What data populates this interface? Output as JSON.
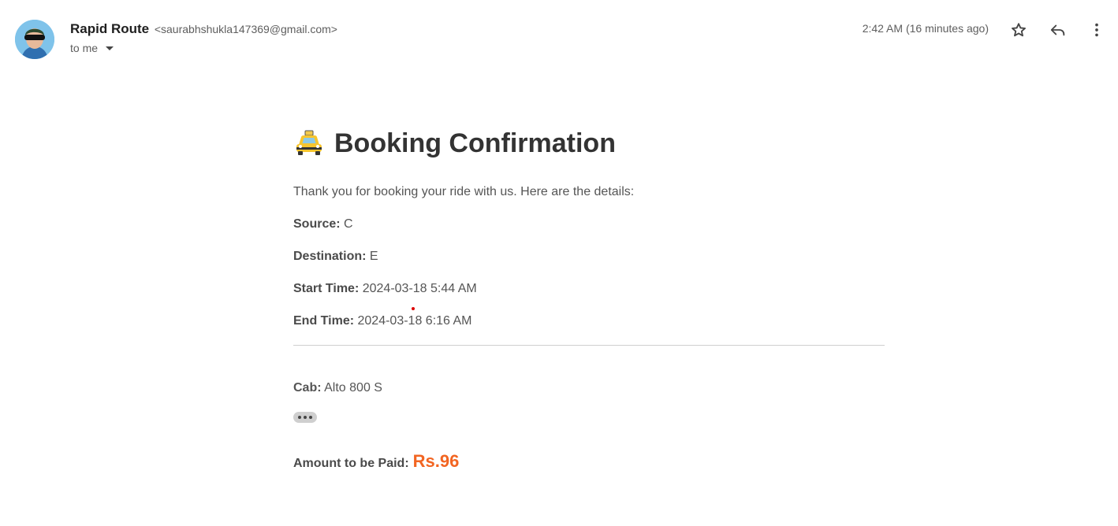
{
  "header": {
    "sender_name": "Rapid Route",
    "sender_email": "<saurabhshukla147369@gmail.com>",
    "recipient": "to me",
    "timestamp": "2:42 AM (16 minutes ago)"
  },
  "email": {
    "title": "Booking Confirmation",
    "intro": "Thank you for booking your ride with us. Here are the details:",
    "fields": [
      {
        "label": "Source:",
        "value": "C"
      },
      {
        "label": "Destination:",
        "value": "E"
      },
      {
        "label": "Start Time:",
        "value": "2024-03-18 5:44 AM"
      },
      {
        "label": "End Time:",
        "value": "2024-03-18 6:16 AM"
      }
    ],
    "cab": {
      "label": "Cab:",
      "value": "Alto 800 S"
    },
    "amount": {
      "label": "Amount to be Paid:",
      "value": "Rs.96"
    }
  },
  "colors": {
    "amount": "#f26522",
    "divider": "#cfcfcf"
  },
  "icons": [
    "avatar",
    "star-icon",
    "reply-icon",
    "more-vert-icon",
    "taxi-icon",
    "ellipsis-icon"
  ]
}
